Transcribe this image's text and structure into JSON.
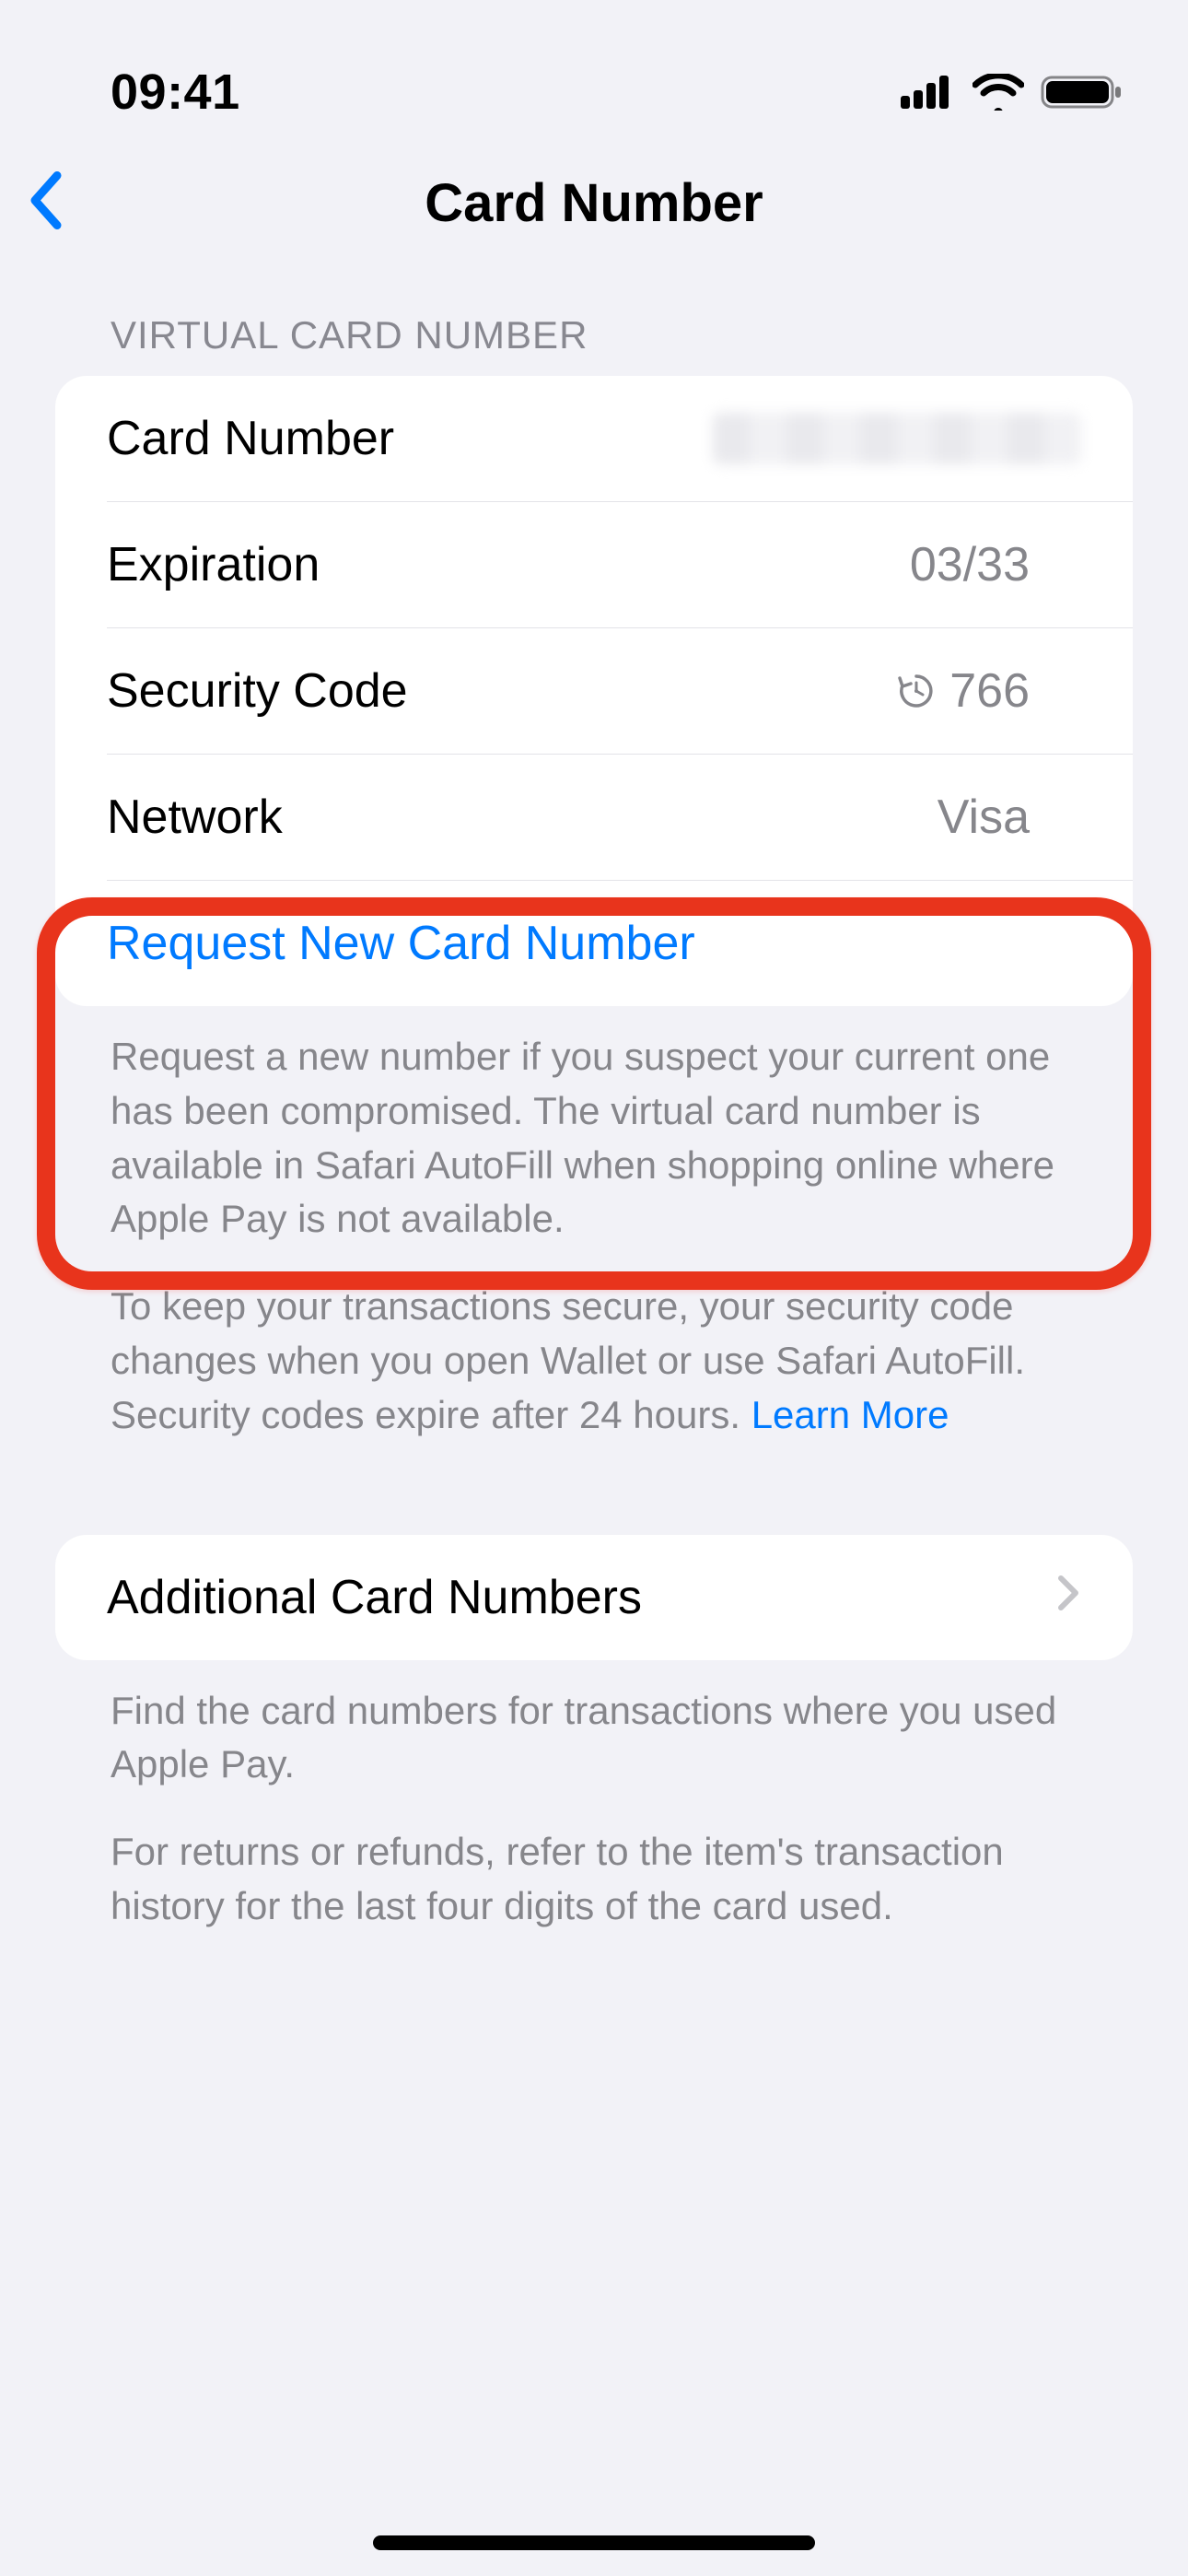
{
  "status": {
    "time": "09:41"
  },
  "nav": {
    "title": "Card Number"
  },
  "section1": {
    "header": "VIRTUAL CARD NUMBER",
    "rows": {
      "cardNumber": {
        "label": "Card Number"
      },
      "expiration": {
        "label": "Expiration",
        "value": "03/33"
      },
      "securityCode": {
        "label": "Security Code",
        "value": "766"
      },
      "network": {
        "label": "Network",
        "value": "Visa"
      },
      "requestNew": {
        "label": "Request New Card Number"
      }
    },
    "footer1": "Request a new number if you suspect your current one has been compromised. The virtual card number is available in Safari AutoFill when shopping online where Apple Pay is not available.",
    "footer2": "To keep your transactions secure, your security code changes when you open Wallet or use Safari AutoFill. Security codes expire after 24 hours. ",
    "learnMore": "Learn More"
  },
  "section2": {
    "row": {
      "label": "Additional Card Numbers"
    },
    "footer1": "Find the card numbers for transactions where you used Apple Pay.",
    "footer2": "For returns or refunds, refer to the item's transaction history for the last four digits of the card used."
  }
}
